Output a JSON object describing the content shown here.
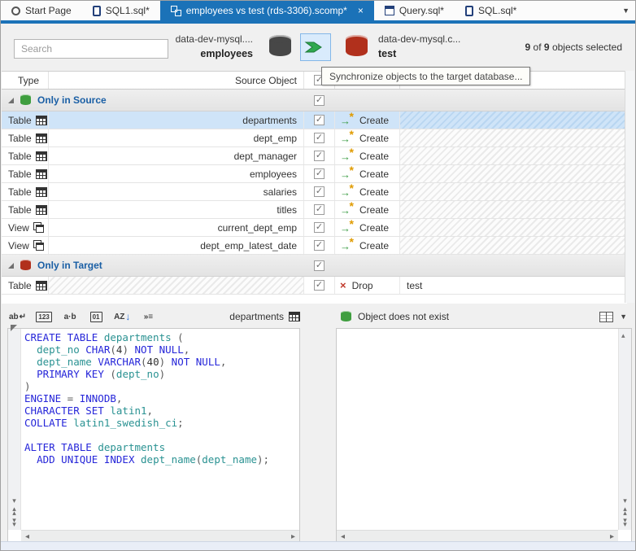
{
  "window": {
    "tab_overflow_icon": "▼"
  },
  "tabs": [
    {
      "label": "Start Page",
      "icon": "start-page-icon"
    },
    {
      "label": "SQL1.sql*",
      "icon": "sql-file-icon"
    },
    {
      "label": "employees vs test (rds-3306).scomp*",
      "icon": "comparison-icon",
      "active": true,
      "close_glyph": "×"
    },
    {
      "label": "Query.sql*",
      "icon": "query-file-icon"
    },
    {
      "label": "SQL.sql*",
      "icon": "sql-file-icon"
    }
  ],
  "header": {
    "search": {
      "placeholder": "Search"
    },
    "source": {
      "server": "data-dev-mysql....",
      "database": "employees"
    },
    "target": {
      "server": "data-dev-mysql.c...",
      "database": "test"
    },
    "selection": {
      "selected": "9",
      "of": "of",
      "total": "9",
      "suffix": "objects selected"
    }
  },
  "tooltip": {
    "text": "Synchronize objects to the target database..."
  },
  "grid": {
    "header": {
      "type": "Type",
      "source": "Source Object"
    },
    "check_glyph": "✓",
    "create_arrow_glyph": "→",
    "create_star_glyph": "*",
    "drop_glyph": "×",
    "groups": [
      {
        "label": "Only in Source",
        "icon": "green-database-icon",
        "rows": [
          {
            "type": "Table",
            "icon": "table-icon",
            "name": "departments",
            "action": "Create",
            "action_icon": "create-icon",
            "selected": true
          },
          {
            "type": "Table",
            "icon": "table-icon",
            "name": "dept_emp",
            "action": "Create",
            "action_icon": "create-icon"
          },
          {
            "type": "Table",
            "icon": "table-icon",
            "name": "dept_manager",
            "action": "Create",
            "action_icon": "create-icon"
          },
          {
            "type": "Table",
            "icon": "table-icon",
            "name": "employees",
            "action": "Create",
            "action_icon": "create-icon"
          },
          {
            "type": "Table",
            "icon": "table-icon",
            "name": "salaries",
            "action": "Create",
            "action_icon": "create-icon"
          },
          {
            "type": "Table",
            "icon": "table-icon",
            "name": "titles",
            "action": "Create",
            "action_icon": "create-icon"
          },
          {
            "type": "View",
            "icon": "view-icon",
            "name": "current_dept_emp",
            "action": "Create",
            "action_icon": "create-icon"
          },
          {
            "type": "View",
            "icon": "view-icon",
            "name": "dept_emp_latest_date",
            "action": "Create",
            "action_icon": "create-icon"
          }
        ]
      },
      {
        "label": "Only in Target",
        "icon": "red-database-icon",
        "rows": [
          {
            "type": "Table",
            "icon": "table-icon",
            "name": "",
            "source_missing": true,
            "action": "Drop",
            "action_icon": "drop-icon",
            "target": "test"
          }
        ]
      }
    ]
  },
  "bottom": {
    "toolbar": {
      "icons": [
        {
          "name": "word-wrap-button",
          "glyph": "ab",
          "extra": "↵"
        },
        {
          "name": "line-numbers-button",
          "glyph": "123",
          "boxed": true
        },
        {
          "name": "show-whitespace-button",
          "glyph": "a·b"
        },
        {
          "name": "binary-view-button",
          "glyph": "01",
          "boxed": true
        },
        {
          "name": "sort-lines-button",
          "glyph": "AZ",
          "extra": "↓",
          "blue": true
        },
        {
          "name": "indent-button",
          "glyph": "»≡"
        }
      ],
      "source_object": {
        "label": "departments"
      },
      "target_status": {
        "label": "Object does not exist"
      },
      "dropdown_glyph": "▼"
    },
    "scroll": {
      "up": "▴",
      "down": "▾",
      "left": "◂",
      "right": "▸"
    },
    "sql": {
      "lines": [
        [
          [
            "k",
            "CREATE TABLE"
          ],
          [
            "d",
            " "
          ],
          [
            "i",
            "departments"
          ],
          [
            "d",
            " ("
          ]
        ],
        [
          [
            "d",
            "  "
          ],
          [
            "i",
            "dept_no"
          ],
          [
            "d",
            " "
          ],
          [
            "k",
            "CHAR"
          ],
          [
            "d",
            "("
          ],
          [
            "n",
            "4"
          ],
          [
            "d",
            ") "
          ],
          [
            "k",
            "NOT NULL"
          ],
          [
            "d",
            ","
          ]
        ],
        [
          [
            "d",
            "  "
          ],
          [
            "i",
            "dept_name"
          ],
          [
            "d",
            " "
          ],
          [
            "k",
            "VARCHAR"
          ],
          [
            "d",
            "("
          ],
          [
            "n",
            "40"
          ],
          [
            "d",
            ") "
          ],
          [
            "k",
            "NOT NULL"
          ],
          [
            "d",
            ","
          ]
        ],
        [
          [
            "d",
            "  "
          ],
          [
            "k",
            "PRIMARY KEY"
          ],
          [
            "d",
            " ("
          ],
          [
            "i",
            "dept_no"
          ],
          [
            "d",
            ")"
          ]
        ],
        [
          [
            "d",
            ")"
          ]
        ],
        [
          [
            "k",
            "ENGINE"
          ],
          [
            "d",
            " = "
          ],
          [
            "k",
            "INNODB"
          ],
          [
            "d",
            ","
          ]
        ],
        [
          [
            "k",
            "CHARACTER SET"
          ],
          [
            "d",
            " "
          ],
          [
            "i",
            "latin1"
          ],
          [
            "d",
            ","
          ]
        ],
        [
          [
            "k",
            "COLLATE"
          ],
          [
            "d",
            " "
          ],
          [
            "i",
            "latin1_swedish_ci"
          ],
          [
            "d",
            ";"
          ]
        ],
        [],
        [
          [
            "k",
            "ALTER TABLE"
          ],
          [
            "d",
            " "
          ],
          [
            "i",
            "departments"
          ]
        ],
        [
          [
            "d",
            "  "
          ],
          [
            "k",
            "ADD UNIQUE INDEX"
          ],
          [
            "d",
            " "
          ],
          [
            "i",
            "dept_name"
          ],
          [
            "d",
            "("
          ],
          [
            "i",
            "dept_name"
          ],
          [
            "d",
            ");"
          ]
        ]
      ]
    }
  },
  "colors": {
    "accent_blue": "#1b72b8",
    "group_label_blue": "#1a5fa5",
    "selected_row": "#cfe4f8",
    "keyword": "#2626d9",
    "identifier": "#2a9292",
    "create_green": "#3a9b42",
    "star_orange": "#e09b00",
    "drop_red": "#c0392b",
    "source_db": "#474747",
    "target_db": "#b1301c"
  }
}
